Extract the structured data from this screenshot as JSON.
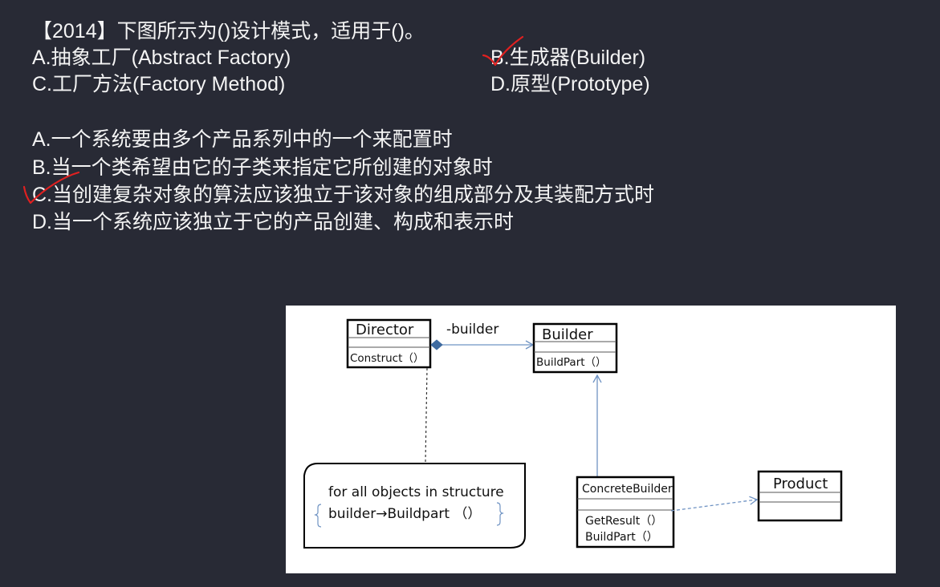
{
  "question": {
    "title": "【2014】下图所示为()设计模式，适用于()。",
    "options_pattern": [
      {
        "key": "A",
        "text": "A.抽象工厂(Abstract Factory)"
      },
      {
        "key": "B",
        "text": "B.生成器(Builder)",
        "marked_correct": true
      },
      {
        "key": "C",
        "text": "C.工厂方法(Factory Method)"
      },
      {
        "key": "D",
        "text": "D.原型(Prototype)"
      }
    ],
    "options_usage": [
      {
        "key": "A",
        "text": "A.一个系统要由多个产品系列中的一个来配置时"
      },
      {
        "key": "B",
        "text": "B.当一个类希望由它的子类来指定它所创建的对象时"
      },
      {
        "key": "C",
        "text": "C.当创建复杂对象的算法应该独立于该对象的组成部分及其装配方式时",
        "marked_correct": true
      },
      {
        "key": "D",
        "text": "D.当一个系统应该独立于它的产品创建、构成和表示时"
      }
    ],
    "check_mark_color": "#e02020"
  },
  "diagram": {
    "director": {
      "name": "Director",
      "operations": [
        "Construct（）"
      ]
    },
    "builder": {
      "name": "Builder",
      "operations": [
        "BuildPart（）"
      ]
    },
    "concrete_builder": {
      "name": "ConcreteBuilder",
      "operations": [
        "GetResult（）",
        "BuildPart（）"
      ]
    },
    "product": {
      "name": "Product"
    },
    "association_label": "-builder",
    "note": {
      "line1": "for all objects in structure",
      "line2": "builder→Buildpart （）"
    },
    "connector_color": "#6f93c3",
    "diamond_color": "#3e6a9f"
  }
}
